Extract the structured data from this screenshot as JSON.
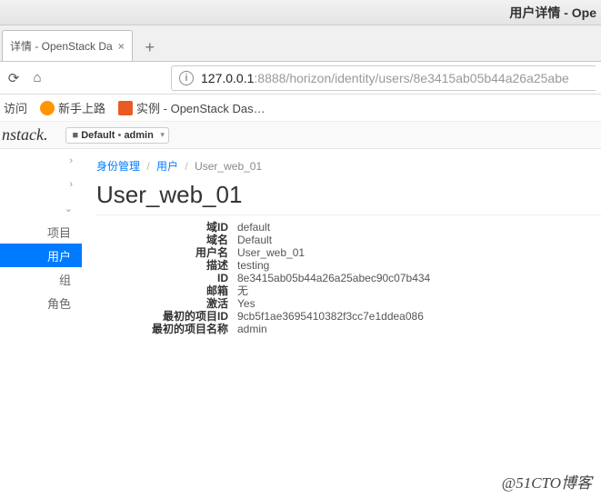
{
  "window": {
    "title": "用户详情 - Ope"
  },
  "tab": {
    "label": "详情 - OpenStack Da"
  },
  "url": {
    "auth": "127.0.0.1",
    "rest": ":8888/horizon/identity/users/8e3415ab05b44a26a25abe"
  },
  "bookmarks": {
    "b0": "访问",
    "b1": "新手上路",
    "b2": "实例 - OpenStack Das…"
  },
  "topbar": {
    "brand": "nstack.",
    "domain_label": "Default",
    "user_label": "admin"
  },
  "sidebar": {
    "item_project": "项目",
    "item_users": "用户",
    "item_groups": "组",
    "item_roles": "角色"
  },
  "breadcrumb": {
    "c0": "身份管理",
    "c1": "用户",
    "c2": "User_web_01"
  },
  "page": {
    "title": "User_web_01"
  },
  "labels": {
    "domain_id": "域ID",
    "domain_name": "域名",
    "user_name": "用户名",
    "desc": "描述",
    "id": "ID",
    "email": "邮箱",
    "active": "激活",
    "proj_id": "最初的项目ID",
    "proj_name": "最初的项目名称"
  },
  "values": {
    "domain_id": "default",
    "domain_name": "Default",
    "user_name": "User_web_01",
    "desc": "testing",
    "id": "8e3415ab05b44a26a25abec90c07b434",
    "email": "无",
    "active": "Yes",
    "proj_id": "9cb5f1ae3695410382f3cc7e1ddea086",
    "proj_name": "admin"
  },
  "watermark": "@51CTO博客"
}
